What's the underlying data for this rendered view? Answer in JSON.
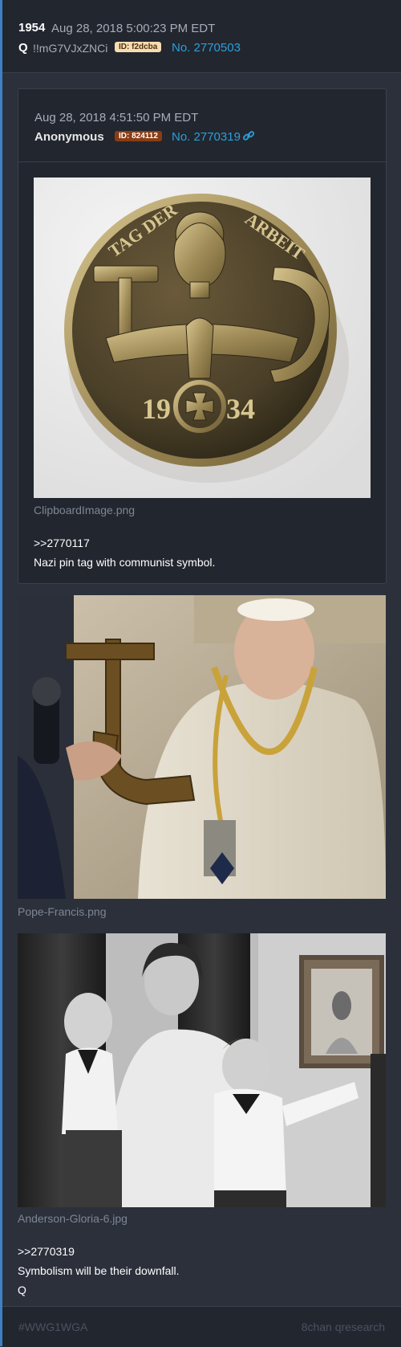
{
  "post": {
    "number": "1954",
    "date": "Aug 28, 2018 5:00:23 PM EDT",
    "author": "Q",
    "tripcode": "!!mG7VJxZNCi",
    "id": "ID: f2dcba",
    "post_no": "No. 2770503"
  },
  "quoted": {
    "date": "Aug 28, 2018 4:51:50 PM EDT",
    "author": "Anonymous",
    "id": "ID: 824112",
    "post_no": "No. 2770319",
    "link_icon": "link-icon",
    "image_file": "ClipboardImage.png",
    "image_text_top_left": "TAG DER",
    "image_text_top_right": "ARBEIT",
    "image_year_left": "19",
    "image_year_right": "34",
    "reply_ref": ">>2770117",
    "message": "Nazi pin tag with communist symbol."
  },
  "images": [
    {
      "file": "Pope-Francis.png"
    },
    {
      "file": "Anderson-Gloria-6.jpg"
    }
  ],
  "body": {
    "reply_ref": ">>2770319",
    "message": "Symbolism will be their downfall.",
    "signature": "Q"
  },
  "footer": {
    "hashtag": "#WWG1WGA",
    "source": "8chan qresearch"
  },
  "colors": {
    "accent": "#2b9fd9",
    "id_q_bg": "#f7dcb2",
    "id_anon_bg": "#8a3d14",
    "left_border": "#3f7fc4"
  }
}
